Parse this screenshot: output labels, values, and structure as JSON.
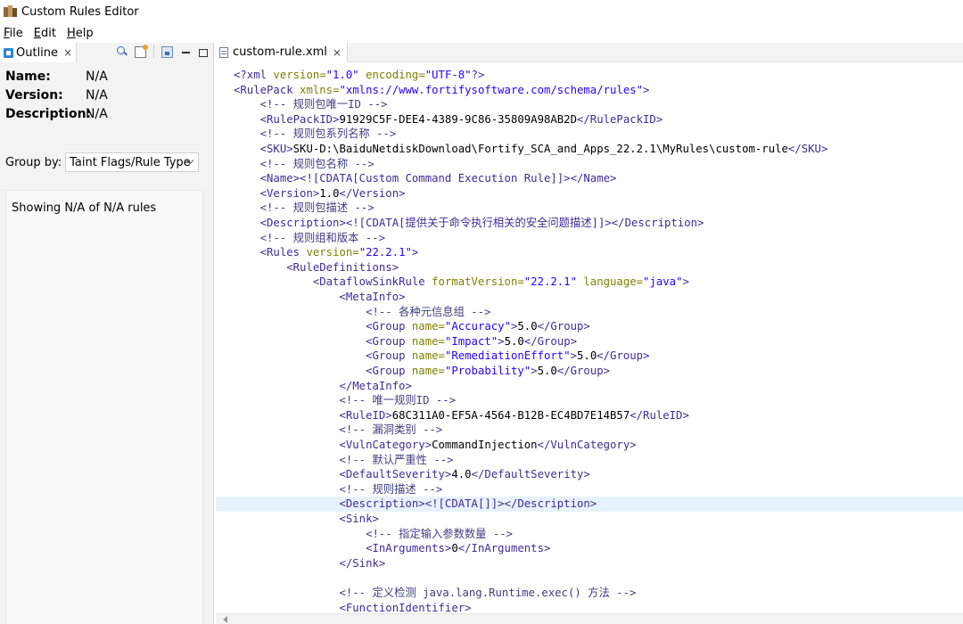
{
  "app": {
    "title": "Custom Rules Editor"
  },
  "menu": [
    {
      "underline": "F",
      "rest": "ile"
    },
    {
      "underline": "E",
      "rest": "dit"
    },
    {
      "underline": "H",
      "rest": "elp"
    }
  ],
  "outline": {
    "tab_label": "Outline",
    "close_glyph": "×",
    "name_label": "Name:",
    "name_value": "N/A",
    "version_label": "Version:",
    "version_value": "N/A",
    "description_label": "Description:",
    "description_value": "N/A",
    "group_by_label": "Group by:",
    "group_by_value": "Taint Flags/Rule Type",
    "showing_text": "Showing N/A of N/A rules"
  },
  "editor": {
    "tab_label": "custom-rule.xml",
    "close_glyph": "×",
    "highlighted_line": 29,
    "lines": [
      [
        [
          "t",
          "<?xml "
        ],
        [
          "a",
          "version="
        ],
        [
          "v",
          "\"1.0\""
        ],
        [
          "a",
          " encoding="
        ],
        [
          "v",
          "\"UTF-8\""
        ],
        [
          "t",
          "?>"
        ]
      ],
      [
        [
          "t",
          "<RulePack "
        ],
        [
          "a",
          "xmlns="
        ],
        [
          "v",
          "\"xmlns://www.fortifysoftware.com/schema/rules\""
        ],
        [
          "t",
          ">"
        ]
      ],
      [
        [
          "x",
          "    "
        ],
        [
          "c",
          "<!-- 规则包唯一ID -->"
        ]
      ],
      [
        [
          "x",
          "    "
        ],
        [
          "t",
          "<RulePackID>"
        ],
        [
          "x",
          "91929C5F-DEE4-4389-9C86-35809A98AB2D"
        ],
        [
          "t",
          "</RulePackID>"
        ]
      ],
      [
        [
          "x",
          "    "
        ],
        [
          "c",
          "<!-- 规则包系列名称 -->"
        ]
      ],
      [
        [
          "x",
          "    "
        ],
        [
          "t",
          "<SKU>"
        ],
        [
          "x",
          "SKU-D:\\BaiduNetdiskDownload\\Fortify_SCA_and_Apps_22.2.1\\MyRules\\custom-rule"
        ],
        [
          "t",
          "</SKU>"
        ]
      ],
      [
        [
          "x",
          "    "
        ],
        [
          "c",
          "<!-- 规则包名称 -->"
        ]
      ],
      [
        [
          "x",
          "    "
        ],
        [
          "t",
          "<Name><![CDATA[Custom Command Execution Rule]]></Name>"
        ]
      ],
      [
        [
          "x",
          "    "
        ],
        [
          "t",
          "<Version>"
        ],
        [
          "x",
          "1.0"
        ],
        [
          "t",
          "</Version>"
        ]
      ],
      [
        [
          "x",
          "    "
        ],
        [
          "c",
          "<!-- 规则包描述 -->"
        ]
      ],
      [
        [
          "x",
          "    "
        ],
        [
          "t",
          "<Description><![CDATA[提供关于命令执行相关的安全问题描述]]></Description>"
        ]
      ],
      [
        [
          "x",
          "    "
        ],
        [
          "c",
          "<!-- 规则组和版本 -->"
        ]
      ],
      [
        [
          "x",
          "    "
        ],
        [
          "t",
          "<Rules "
        ],
        [
          "a",
          "version="
        ],
        [
          "v",
          "\"22.2.1\""
        ],
        [
          "t",
          ">"
        ]
      ],
      [
        [
          "x",
          "        "
        ],
        [
          "t",
          "<RuleDefinitions>"
        ]
      ],
      [
        [
          "x",
          "            "
        ],
        [
          "t",
          "<DataflowSinkRule "
        ],
        [
          "a",
          "formatVersion="
        ],
        [
          "v",
          "\"22.2.1\""
        ],
        [
          "a",
          " language="
        ],
        [
          "v",
          "\"java\""
        ],
        [
          "t",
          ">"
        ]
      ],
      [
        [
          "x",
          "                "
        ],
        [
          "t",
          "<MetaInfo>"
        ]
      ],
      [
        [
          "x",
          "                    "
        ],
        [
          "c",
          "<!-- 各种元信息组 -->"
        ]
      ],
      [
        [
          "x",
          "                    "
        ],
        [
          "t",
          "<Group "
        ],
        [
          "a",
          "name="
        ],
        [
          "v",
          "\"Accuracy\""
        ],
        [
          "t",
          ">"
        ],
        [
          "x",
          "5.0"
        ],
        [
          "t",
          "</Group>"
        ]
      ],
      [
        [
          "x",
          "                    "
        ],
        [
          "t",
          "<Group "
        ],
        [
          "a",
          "name="
        ],
        [
          "v",
          "\"Impact\""
        ],
        [
          "t",
          ">"
        ],
        [
          "x",
          "5.0"
        ],
        [
          "t",
          "</Group>"
        ]
      ],
      [
        [
          "x",
          "                    "
        ],
        [
          "t",
          "<Group "
        ],
        [
          "a",
          "name="
        ],
        [
          "v",
          "\"RemediationEffort\""
        ],
        [
          "t",
          ">"
        ],
        [
          "x",
          "5.0"
        ],
        [
          "t",
          "</Group>"
        ]
      ],
      [
        [
          "x",
          "                    "
        ],
        [
          "t",
          "<Group "
        ],
        [
          "a",
          "name="
        ],
        [
          "v",
          "\"Probability\""
        ],
        [
          "t",
          ">"
        ],
        [
          "x",
          "5.0"
        ],
        [
          "t",
          "</Group>"
        ]
      ],
      [
        [
          "x",
          "                "
        ],
        [
          "t",
          "</MetaInfo>"
        ]
      ],
      [
        [
          "x",
          "                "
        ],
        [
          "c",
          "<!-- 唯一规则ID -->"
        ]
      ],
      [
        [
          "x",
          "                "
        ],
        [
          "t",
          "<RuleID>"
        ],
        [
          "x",
          "68C311A0-EF5A-4564-B12B-EC4BD7E14B57"
        ],
        [
          "t",
          "</RuleID>"
        ]
      ],
      [
        [
          "x",
          "                "
        ],
        [
          "c",
          "<!-- 漏洞类别 -->"
        ]
      ],
      [
        [
          "x",
          "                "
        ],
        [
          "t",
          "<VulnCategory>"
        ],
        [
          "x",
          "CommandInjection"
        ],
        [
          "t",
          "</VulnCategory>"
        ]
      ],
      [
        [
          "x",
          "                "
        ],
        [
          "c",
          "<!-- 默认严重性 -->"
        ]
      ],
      [
        [
          "x",
          "                "
        ],
        [
          "t",
          "<DefaultSeverity>"
        ],
        [
          "x",
          "4.0"
        ],
        [
          "t",
          "</DefaultSeverity>"
        ]
      ],
      [
        [
          "x",
          "                "
        ],
        [
          "c",
          "<!-- 规则描述 -->"
        ]
      ],
      [
        [
          "x",
          "                "
        ],
        [
          "t",
          "<Description><![CDATA[]]></Description>"
        ]
      ],
      [
        [
          "x",
          "                "
        ],
        [
          "t",
          "<Sink>"
        ]
      ],
      [
        [
          "x",
          "                    "
        ],
        [
          "c",
          "<!-- 指定输入参数数量 -->"
        ]
      ],
      [
        [
          "x",
          "                    "
        ],
        [
          "t",
          "<InArguments>"
        ],
        [
          "x",
          "0"
        ],
        [
          "t",
          "</InArguments>"
        ]
      ],
      [
        [
          "x",
          "                "
        ],
        [
          "t",
          "</Sink>"
        ]
      ],
      [],
      [
        [
          "x",
          "                "
        ],
        [
          "c",
          "<!-- 定义检测 java.lang.Runtime.exec() 方法 -->"
        ]
      ],
      [
        [
          "x",
          "                "
        ],
        [
          "t",
          "<FunctionIdentifier>"
        ]
      ]
    ]
  }
}
